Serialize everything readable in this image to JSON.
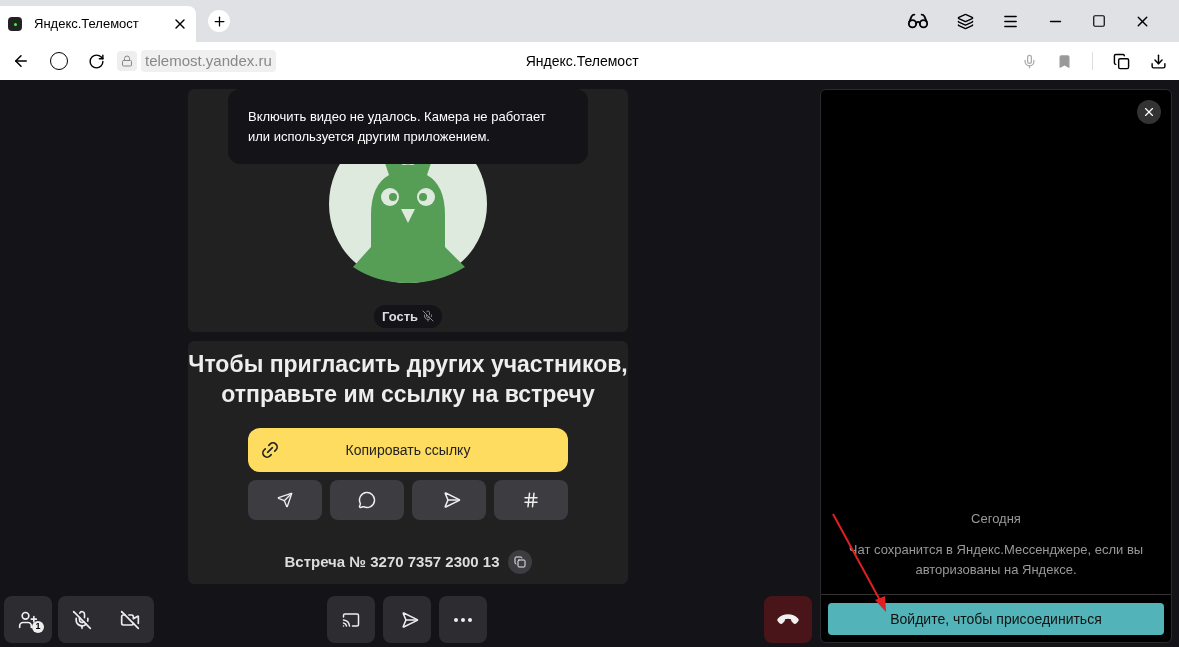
{
  "browser": {
    "tab_title": "Яндекс.Телемост",
    "address": "telemost.yandex.ru",
    "page_title": "Яндекс.Телемост"
  },
  "video": {
    "toast": "Включить видео не удалось. Камера не работает или используется другим приложением.",
    "participant": "Гость",
    "participant_muted": true
  },
  "invite": {
    "heading": "Чтобы пригласить других участников, отправьте им ссылку на встречу",
    "copy_button": "Копировать ссылку",
    "meeting_number": "Встреча № 3270 7357 2300 13"
  },
  "toolbar": {
    "participants_count": "1",
    "mic_muted": true,
    "camera_off": true
  },
  "chat": {
    "date": "Сегодня",
    "notice": "Чат сохранится в Яндекс.Мессенджере, если вы авторизованы на Яндексе.",
    "join_button": "Войдите, чтобы присоединиться"
  }
}
